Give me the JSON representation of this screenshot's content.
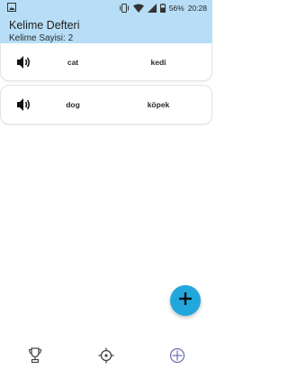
{
  "status_bar": {
    "battery": "56%",
    "time": "20:28",
    "icons": [
      "image-icon",
      "vibrate-icon",
      "wifi-icon",
      "signal-icon",
      "battery-icon"
    ]
  },
  "header": {
    "title": "Kelime Defteri",
    "subtitle": "Kelime Sayisi: 2",
    "background": "#b7def6"
  },
  "words": [
    {
      "english": "cat",
      "turkish": "kedi",
      "icon": "speaker-icon"
    },
    {
      "english": "dog",
      "turkish": "köpek",
      "icon": "speaker-icon"
    }
  ],
  "fab": {
    "icon": "plus-icon",
    "color": "#22a7dd"
  },
  "bottom_nav": {
    "items": [
      {
        "icon": "trophy-icon"
      },
      {
        "icon": "target-icon"
      },
      {
        "icon": "add-circle-icon"
      }
    ]
  }
}
